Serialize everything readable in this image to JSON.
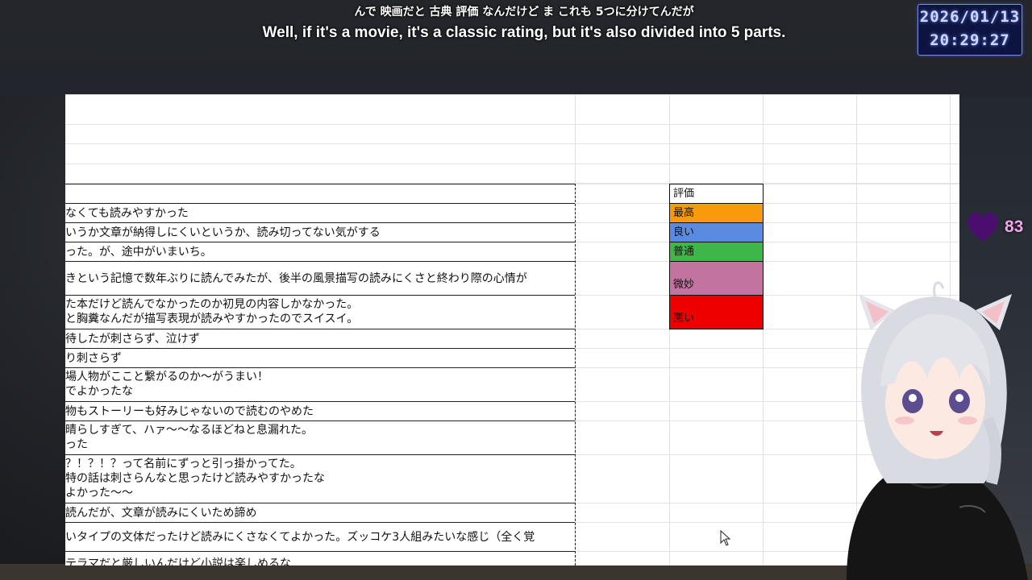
{
  "subtitles": {
    "japanese": "んで 映画だと 古典 評価 なんだけど ま これも 5つに分けてんだが",
    "english": "Well, if it's a movie, it's a classic rating, but it's also divided into 5 parts."
  },
  "clock": {
    "date": "2026/01/13",
    "time": "20:29:27"
  },
  "hearts": {
    "count": "83",
    "color": "#4a0e6e"
  },
  "sheet": {
    "rows": [
      {
        "lines": [
          ""
        ],
        "top": 0
      },
      {
        "lines": [
          "なくても読みやすかった"
        ]
      },
      {
        "lines": [
          "いうか文章が納得しにくいというか、読み切ってない気がする"
        ]
      },
      {
        "lines": [
          "った。が、途中がいまいち。"
        ]
      },
      {
        "lines": [
          "きという記憶で数年ぶりに読んでみたが、後半の風景描写の読みにくさと終わり際の心情が"
        ]
      },
      {
        "lines": [
          "た本だけど読んでなかったのか初見の内容しかなかった。",
          "と胸糞なんだが描写表現が読みやすかったのでスイスイ。"
        ]
      },
      {
        "lines": [
          "待したが刺さらず、泣けず"
        ]
      },
      {
        "lines": [
          "り刺さらず"
        ]
      },
      {
        "lines": [
          "場人物がここと繋がるのか～がうまい！",
          "でよかったな"
        ]
      },
      {
        "lines": [
          "物もストーリーも好みじゃないので読むのやめた"
        ]
      },
      {
        "lines": [
          "晴らしすぎて、ハァ～～なるほどねと息漏れた。",
          "った"
        ]
      },
      {
        "lines": [
          "？！？！？って名前にずっと引っ掛かってた。",
          "特の話は刺さらんなと思ったけど読みやすかったな",
          "よかった～～"
        ]
      },
      {
        "lines": [
          "読んだが、文章が読みにくいため諦め"
        ]
      },
      {
        "lines": [
          "いタイプの文体だったけど読みにくさなくてよかった。ズッコケ3人組みたいな感じ（全く覚"
        ]
      },
      {
        "lines": [
          "テラマだと厳しいんだけど小説は楽しめるな"
        ]
      }
    ],
    "legend": [
      {
        "label": "評価",
        "color": "#ffffff"
      },
      {
        "label": "最高",
        "color": "#f79b0c"
      },
      {
        "label": "良い",
        "color": "#5b8be0"
      },
      {
        "label": "普通",
        "color": "#3fb64a"
      },
      {
        "label": "微妙",
        "color": "#c2739f"
      },
      {
        "label": "悪い",
        "color": "#ee0000"
      }
    ]
  },
  "icons": {
    "heart": "heart-icon",
    "cursor": "mouse-cursor-icon",
    "avatar": "vtuber-avatar"
  }
}
